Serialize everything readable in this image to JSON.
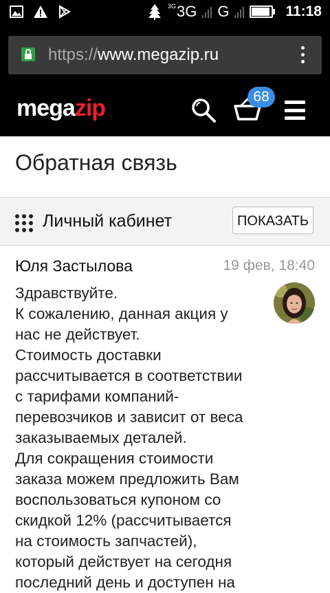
{
  "status_bar": {
    "network_small": "3G",
    "network_main": "3G",
    "network_secondary": "G",
    "battery_level": 0.85,
    "time": "11:18"
  },
  "browser": {
    "url_protocol": "https://",
    "url_host": "www.megazip.ru"
  },
  "header": {
    "logo_part1": "mega",
    "logo_part2": "zip",
    "cart_count": "68",
    "brand_color": "#e8202a",
    "badge_color": "#3a8ee6"
  },
  "page": {
    "title": "Обратная связь"
  },
  "cabinet": {
    "label": "Личный кабинет",
    "show_button": "ПОКАЗАТЬ"
  },
  "message": {
    "author": "Юля Застылова",
    "date": "19 фев, 18:40",
    "lines": [
      "Здравствуйте.",
      "К сожалению, данная акция у",
      "нас не действует.",
      "Стоимость доставки",
      "рассчитывается в соответствии",
      "с тарифами компаний-",
      "перевозчиков и зависит от веса",
      "заказываемых деталей.",
      "Для сокращения стоимости",
      "заказа можем предложить Вам",
      "воспользоваться купоном со",
      "скидкой 12% (рассчитывается",
      "на стоимость запчастей),",
      "который действует на сегодня",
      "последний день и доступен на"
    ]
  }
}
